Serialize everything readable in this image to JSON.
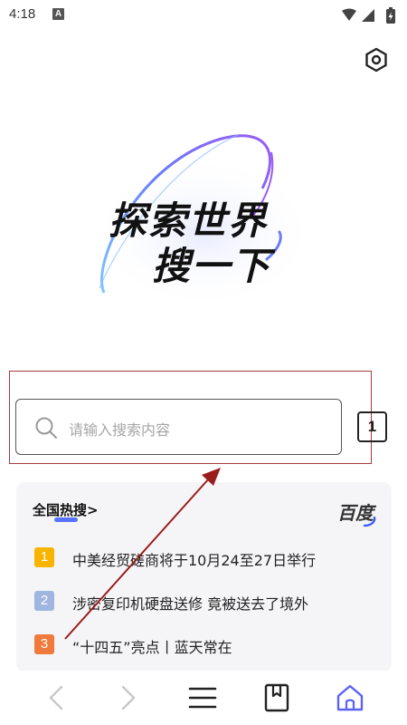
{
  "status_bar": {
    "time": "4:18",
    "notification_letter": "A",
    "icons": [
      "wifi-icon",
      "signal-icon",
      "battery-icon"
    ]
  },
  "header": {
    "settings_icon": "settings-icon"
  },
  "hero": {
    "line1": "探索世界",
    "line2": "搜一下"
  },
  "search": {
    "placeholder": "请输入搜索内容",
    "tab_count": "1"
  },
  "hot_search": {
    "title": "全国热搜>",
    "source": "百度",
    "items": [
      {
        "rank": "1",
        "text": "中美经贸磋商将于10月24至27日举行",
        "color": "#f8b400"
      },
      {
        "rank": "2",
        "text": "涉密复印机硬盘送修 竟被送去了境外",
        "color": "#9fb6e0"
      },
      {
        "rank": "3",
        "text": "“十四五”亮点丨蓝天常在",
        "color": "#ef7a3c"
      }
    ]
  },
  "bottom_nav": {
    "items": [
      "back-icon",
      "forward-icon",
      "menu-icon",
      "bookmarks-icon",
      "home-icon"
    ],
    "active": "home-icon"
  },
  "colors": {
    "highlight": "#a83a3e",
    "accent": "#5b63f5"
  }
}
